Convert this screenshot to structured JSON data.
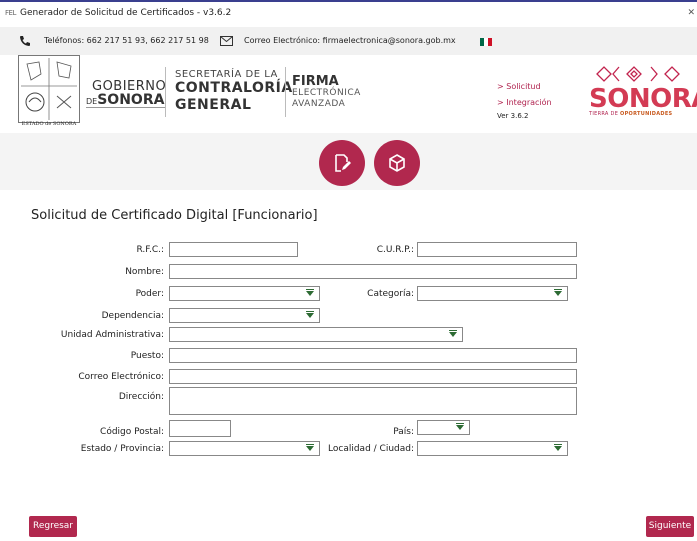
{
  "window": {
    "title": "Generador de Solicitud de Certificados - v3.6.2",
    "app_icon_text": "FEL"
  },
  "contact": {
    "phone": "Teléfonos: 662 217 51 93, 662 217 51 98",
    "email": "Correo Electrónico: firmaelectronica@sonora.gob.mx",
    "flag_colors": [
      "#006847",
      "#ffffff",
      "#ce1126"
    ]
  },
  "header": {
    "shield_caption": "ESTADO de SONORA",
    "gobierno_line1": "GOBIERNO",
    "gobierno_de": "DE",
    "gobierno_line2": "SONORA",
    "secretaria_line1": "SECRETARÍA DE LA",
    "secretaria_line2": "CONTRALORÍA",
    "secretaria_line3": "GENERAL",
    "firma_line1": "FIRMA",
    "firma_line2": "ELECTRÓNICA",
    "firma_line3": "AVANZADA",
    "nav_solicitud": "> Solicitud",
    "nav_integracion": "> Integración",
    "version": "Ver 3.6.2",
    "sonora_word": "SONORA",
    "sonora_tag_pre": "TIERRA DE ",
    "sonora_tag_bold": "OPORTUNIDADES"
  },
  "banner": {
    "buttons": [
      "edit-document-icon",
      "cube-icon"
    ],
    "accent": "#b1284e"
  },
  "form": {
    "title": "Solicitud de Certificado Digital [Funcionario]",
    "labels": {
      "rfc": "R.F.C.:",
      "curp": "C.U.R.P.:",
      "nombre": "Nombre:",
      "poder": "Poder:",
      "categoria": "Categoría:",
      "dependencia": "Dependencia:",
      "unidad": "Unidad Administrativa:",
      "puesto": "Puesto:",
      "correo": "Correo Electrónico:",
      "direccion": "Dirección:",
      "cp": "Código Postal:",
      "pais": "País:",
      "estado": "Estado / Provincia:",
      "localidad": "Localidad / Ciudad:"
    },
    "values": {
      "rfc": "",
      "curp": "",
      "nombre": "",
      "poder": "",
      "categoria": "",
      "dependencia": "",
      "unidad": "",
      "puesto": "",
      "correo": "",
      "direccion": "",
      "cp": "",
      "pais": "",
      "estado": "",
      "localidad": ""
    }
  },
  "footer": {
    "back": "Regresar",
    "next": "Siguiente"
  }
}
